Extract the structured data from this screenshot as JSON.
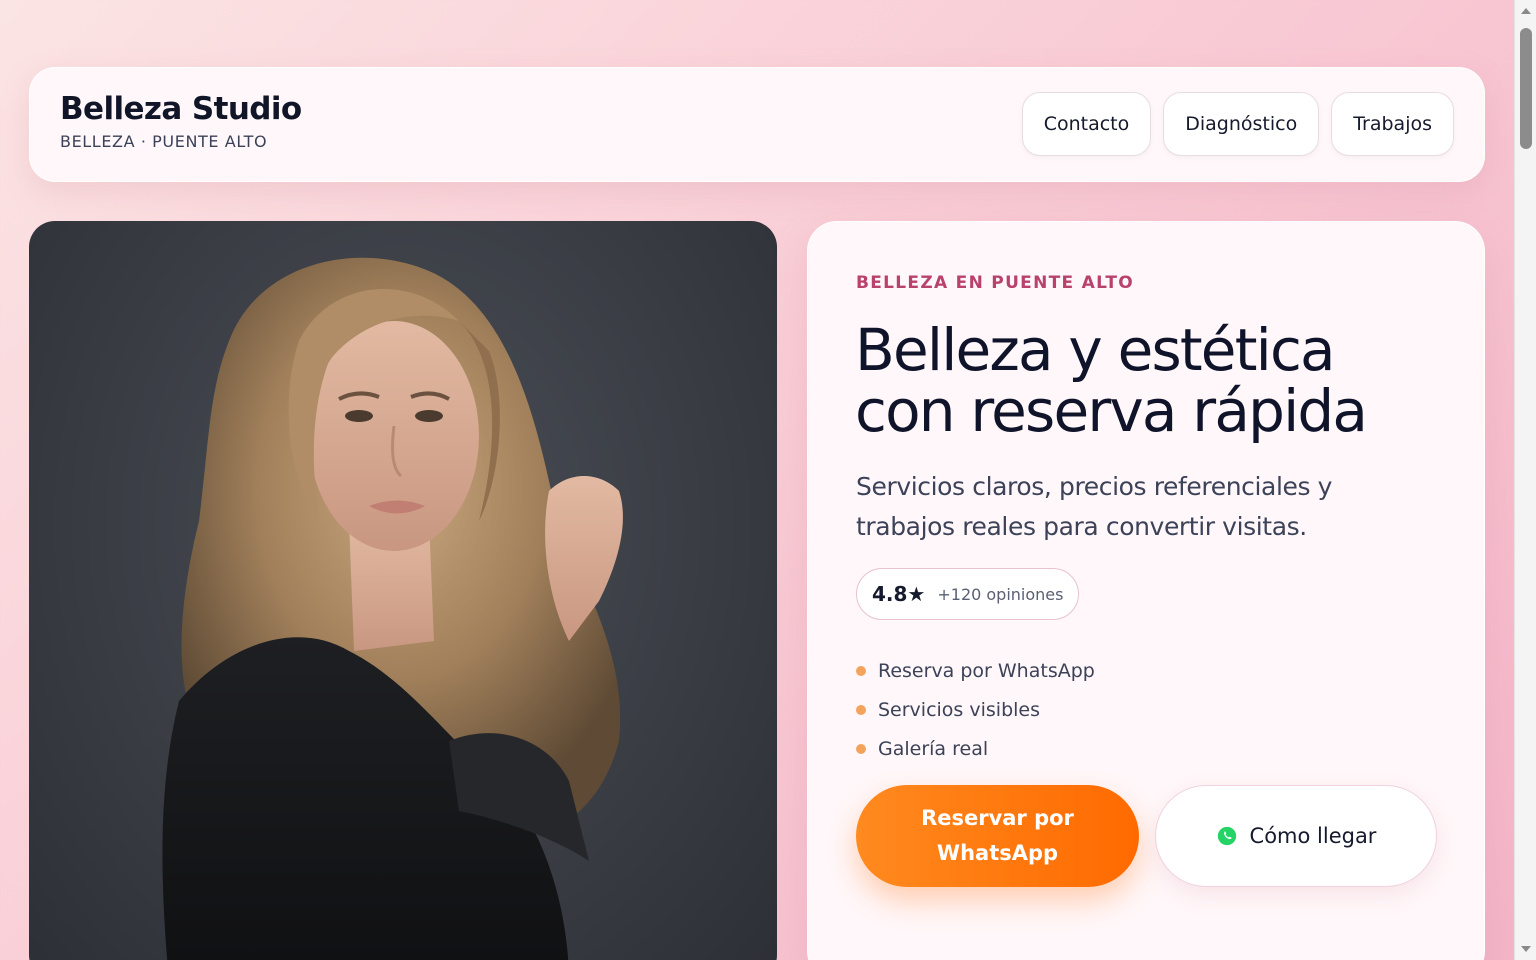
{
  "header": {
    "brand_name": "Belleza Studio",
    "brand_sub": "BELLEZA · PUENTE ALTO",
    "nav": [
      {
        "label": "Contacto"
      },
      {
        "label": "Diagnóstico"
      },
      {
        "label": "Trabajos"
      }
    ]
  },
  "hero": {
    "eyebrow": "BELLEZA EN PUENTE ALTO",
    "title_line1": "Belleza y estética",
    "title_line2": "con reserva rápida",
    "description": "Servicios claros, precios referenciales y trabajos reales para convertir visitas.",
    "rating": {
      "score": "4.8★",
      "count": "+120 opiniones"
    },
    "features": [
      {
        "label": "Reserva por WhatsApp"
      },
      {
        "label": "Servicios visibles"
      },
      {
        "label": "Galería real"
      }
    ],
    "primary_cta": "Reservar por WhatsApp",
    "secondary_cta": "Cómo llegar"
  },
  "icons": {
    "secondary_cta_icon": "whatsapp-icon"
  },
  "colors": {
    "accent": "#ff7a10",
    "eyebrow": "#b8426b",
    "feature_dot": "#f4a35d",
    "whatsapp": "#25d366"
  }
}
